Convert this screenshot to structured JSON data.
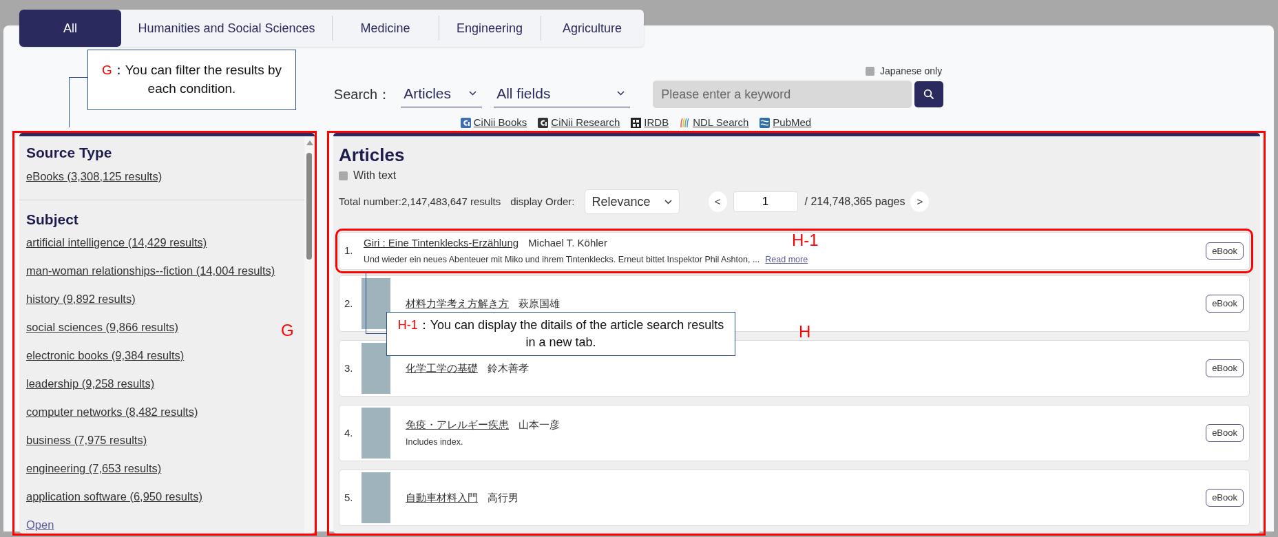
{
  "tabs": [
    {
      "label": "All",
      "selected": true
    },
    {
      "label": "Humanities and Social Sciences",
      "selected": false
    },
    {
      "label": "Medicine",
      "selected": false
    },
    {
      "label": "Engineering",
      "selected": false
    },
    {
      "label": "Agriculture",
      "selected": false
    }
  ],
  "search": {
    "japanese_only": {
      "label": "Japanese only",
      "checked": false
    },
    "label": "Search：",
    "type_select": "Articles",
    "field_select": "All fields",
    "placeholder": "Please enter a keyword"
  },
  "external_links": [
    {
      "label": "CiNii Books",
      "kind": "cinii"
    },
    {
      "label": "CiNii Research",
      "kind": "ciniidark"
    },
    {
      "label": "IRDB",
      "kind": "irdb"
    },
    {
      "label": "NDL Search",
      "kind": "ndl"
    },
    {
      "label": "PubMed",
      "kind": "pubmed"
    }
  ],
  "facets": [
    {
      "title": "Source Type",
      "items": [
        "eBooks (3,308,125 results)"
      ]
    },
    {
      "title": "Subject",
      "items": [
        "artificial intelligence (14,429 results)",
        "man-woman relationships--fiction (14,004 results)",
        "history (9,892 results)",
        "social sciences (9,866 results)",
        "electronic books (9,384 results)",
        "leadership (9,258 results)",
        "computer networks (8,482 results)",
        "business (7,975 results)",
        "engineering (7,653 results)",
        "application software (6,950 results)"
      ],
      "more": "Open"
    }
  ],
  "results": {
    "title": "Articles",
    "with_text": {
      "label": "With text",
      "checked": false
    },
    "total": "Total number:2,147,483,647 results",
    "order_label": "display Order:",
    "order": "Relevance",
    "prev": "<",
    "page": "1",
    "pages": "/ 214,748,365 pages",
    "next": ">",
    "items": [
      {
        "number": "1.",
        "title": "Giri : Eine Tintenklecks-Erzählung",
        "author": "Michael T. Köhler",
        "description": "Und wieder ein neues Abenteuer mit Miko und ihrem Tintenklecks. Erneut bittet Inspektor Phil Ashton, ...",
        "read_more": "Read more",
        "thumbnail": false,
        "badge": "eBook",
        "highlighted": true
      },
      {
        "number": "2.",
        "title": "材料力学考え方解き方",
        "author": "萩原国雄",
        "thumbnail": true,
        "badge": "eBook",
        "highlighted": false
      },
      {
        "number": "3.",
        "title": "化学工学の基礎",
        "author": "鈴木善孝",
        "thumbnail": true,
        "badge": "eBook",
        "highlighted": false
      },
      {
        "number": "4.",
        "title": "免疫・アレルギー疾患",
        "author": "山本一彦",
        "description": "Includes index.",
        "thumbnail": true,
        "badge": "eBook",
        "highlighted": false
      },
      {
        "number": "5.",
        "title": "自動車材料入門",
        "author": "高行男",
        "thumbnail": true,
        "badge": "eBook",
        "highlighted": false
      }
    ]
  },
  "annotations": {
    "callouts": [
      {
        "marker": "G",
        "text": "：You can filter the results by each condition."
      },
      {
        "marker": "H-1",
        "text": "：You can display the ditails of the article search results in a new tab."
      }
    ],
    "region_labels": [
      "G",
      "H",
      "H-1"
    ]
  }
}
